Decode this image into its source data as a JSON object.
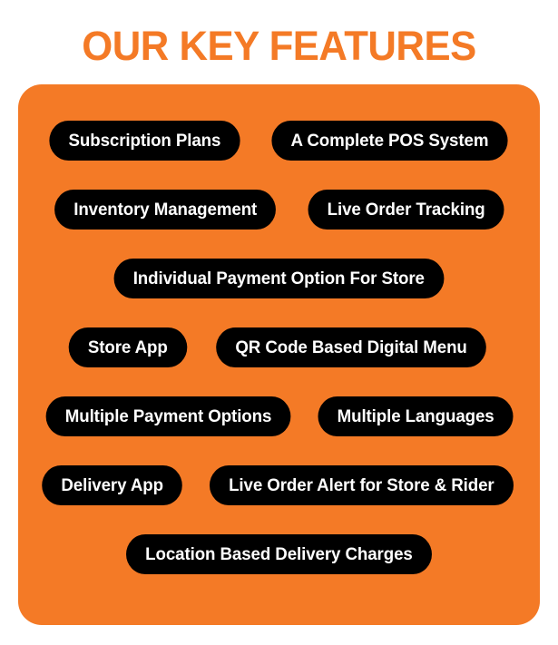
{
  "heading": {
    "text": "OUR KEY FEATURES",
    "color": "#F47A26"
  },
  "panel": {
    "background_color": "#F47A26",
    "pill_background_color": "#000000",
    "pill_text_color": "#FFFFFF",
    "rows": [
      {
        "pills": [
          {
            "label": "Subscription Plans"
          },
          {
            "label": "A Complete POS System"
          }
        ]
      },
      {
        "pills": [
          {
            "label": "Inventory Management"
          },
          {
            "label": "Live Order Tracking"
          }
        ]
      },
      {
        "pills": [
          {
            "label": "Individual Payment Option For Store"
          }
        ]
      },
      {
        "pills": [
          {
            "label": "Store App"
          },
          {
            "label": "QR Code Based Digital Menu"
          }
        ]
      },
      {
        "pills": [
          {
            "label": "Multiple Payment Options"
          },
          {
            "label": "Multiple Languages"
          }
        ]
      },
      {
        "pills": [
          {
            "label": "Delivery App"
          },
          {
            "label": "Live Order Alert for Store & Rider"
          }
        ]
      },
      {
        "pills": [
          {
            "label": "Location Based Delivery Charges"
          }
        ]
      }
    ]
  }
}
